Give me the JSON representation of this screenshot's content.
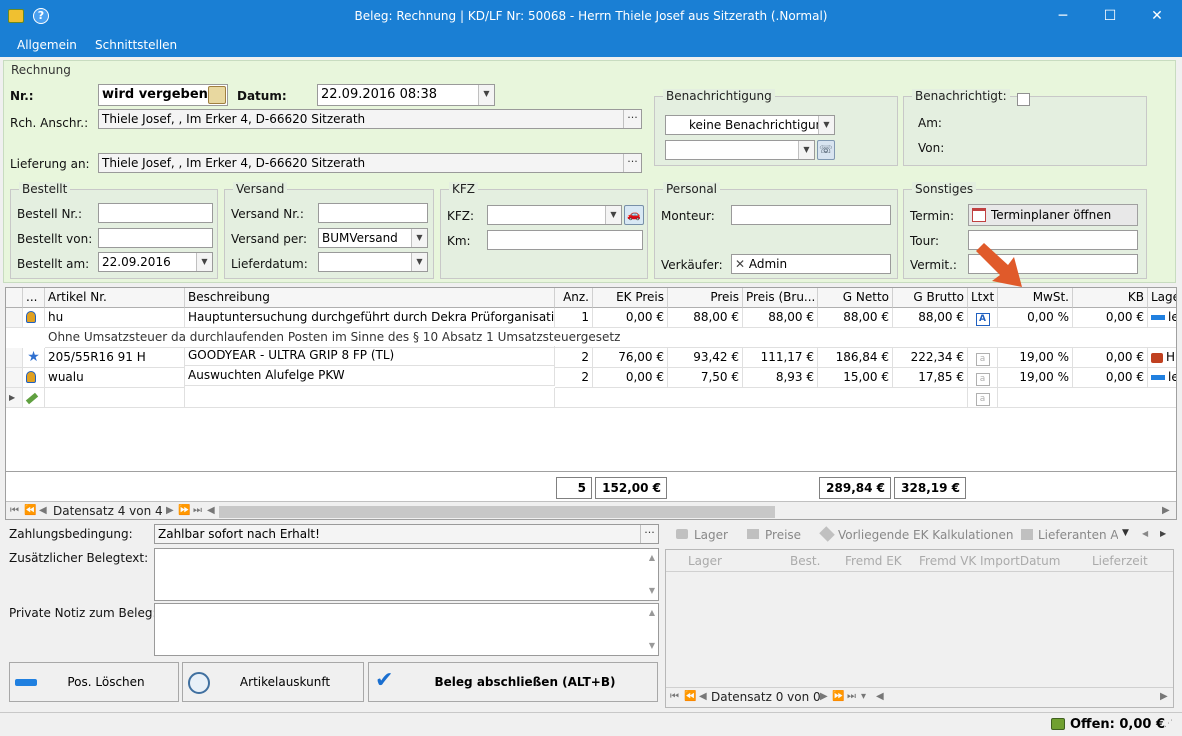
{
  "window": {
    "title": "Beleg: Rechnung |  KD/LF Nr: 50068 - Herrn Thiele Josef aus Sitzerath (.Normal)",
    "minimize": "─",
    "maximize": "☐",
    "close": "✕"
  },
  "menu": {
    "items": [
      "Allgemein",
      "Schnittstellen"
    ]
  },
  "rechnung": {
    "group_label": "Rechnung",
    "nr_label": "Nr.:",
    "nr_value": "wird vergeben",
    "datum_label": "Datum:",
    "datum_value": "22.09.2016 08:38",
    "anschr_label": "Rch. Anschr.:",
    "anschr_value": "Thiele Josef, , Im Erker 4, D-66620 Sitzerath",
    "lieferung_label": "Lieferung an:",
    "lieferung_value": "Thiele Josef, , Im Erker 4, D-66620 Sitzerath"
  },
  "benachrichtigung": {
    "group_label": "Benachrichtigung",
    "value": "keine Benachrichtigung",
    "second_value": ""
  },
  "benachrichtigt": {
    "group_label": "Benachrichtigt:",
    "am_label": "Am:",
    "von_label": "Von:"
  },
  "bestellt": {
    "group_label": "Bestellt",
    "nr_label": "Bestell Nr.:",
    "nr_value": "",
    "von_label": "Bestellt von:",
    "von_value": "",
    "am_label": "Bestellt am:",
    "am_value": "22.09.2016"
  },
  "versand": {
    "group_label": "Versand",
    "nr_label": "Versand Nr.:",
    "nr_value": "",
    "per_label": "Versand per:",
    "per_value": "BUMVersand",
    "datum_label": "Lieferdatum:",
    "datum_value": ""
  },
  "kfz": {
    "group_label": "KFZ",
    "kfz_label": "KFZ:",
    "kfz_value": "",
    "km_label": "Km:",
    "km_value": ""
  },
  "personal": {
    "group_label": "Personal",
    "monteur_label": "Monteur:",
    "monteur_value": "",
    "verkaeufer_label": "Verkäufer:",
    "verkaeufer_value": "Admin"
  },
  "sonstiges": {
    "group_label": "Sonstiges",
    "termin_label": "Termin:",
    "termin_button": "Terminplaner öffnen",
    "tour_label": "Tour:",
    "tour_value": "",
    "vermit_label": "Vermit.:",
    "vermit_value": ""
  },
  "grid": {
    "columns": [
      "...",
      "Artikel Nr.",
      "Beschreibung",
      "Anz.",
      "EK Preis",
      "Preis",
      "Preis (Bru...",
      "G Netto",
      "G Brutto",
      "Ltxt",
      "MwSt.",
      "KB",
      "Lage"
    ],
    "rows": [
      {
        "artikel": "hu",
        "beschreibung": "Hauptuntersuchung durchgeführt durch Dekra Prüforganisation.",
        "anz": "1",
        "ek": "0,00 €",
        "preis": "88,00 €",
        "brutto": "88,00 €",
        "gnetto": "88,00 €",
        "gbrutto": "88,00 €",
        "mwst": "0,00 %",
        "kb": "0,00 €",
        "lager": "le"
      },
      {
        "artikel": "205/55R16 91 H",
        "beschreibung": "GOODYEAR - ULTRA GRIP 8 FP (TL)",
        "anz": "2",
        "ek": "76,00 €",
        "preis": "93,42 €",
        "brutto": "111,17 €",
        "gnetto": "186,84 €",
        "gbrutto": "222,34 €",
        "mwst": "19,00 %",
        "kb": "0,00 €",
        "lager": "H"
      },
      {
        "artikel": "wualu",
        "beschreibung": "Auswuchten Alufelge PKW",
        "anz": "2",
        "ek": "0,00 €",
        "preis": "7,50 €",
        "brutto": "8,93 €",
        "gnetto": "15,00 €",
        "gbrutto": "17,85 €",
        "mwst": "19,00 %",
        "kb": "0,00 €",
        "lager": "le"
      }
    ],
    "note": "Ohne Umsatzsteuer da durchlaufenden Posten im Sinne des § 10 Absatz 1 Umsatzsteuergesetz",
    "totals": {
      "anz": "5",
      "ek": "152,00 €",
      "gnetto": "289,84 €",
      "gbrutto": "328,19 €"
    },
    "record_nav": "Datensatz 4 von 4"
  },
  "footer": {
    "zahlung_label": "Zahlungsbedingung:",
    "zahlung_value": "Zahlbar sofort nach Erhalt!",
    "belegtext_label": "Zusätzlicher Belegtext:",
    "notiz_label": "Private Notiz zum Beleg:",
    "btn_loeschen": "Pos. Löschen",
    "btn_artikel": "Artikelauskunft",
    "btn_abschliessen": "Beleg abschließen (ALT+B)"
  },
  "sidepanel": {
    "tabs": [
      "Lager",
      "Preise",
      "Vorliegende EK Kalkulationen",
      "Lieferanten Ar"
    ],
    "columns": [
      "Lager",
      "Best.",
      "Fremd EK",
      "Fremd VK",
      "ImportDatum",
      "Lieferzeit"
    ],
    "record_nav": "Datensatz 0 von 0"
  },
  "status": {
    "offen": "Offen: 0,00 €"
  },
  "colors": {
    "titlebar": "#1a7fd4",
    "header_bg": "#e8f6dc",
    "arrow": "#e05a2a"
  }
}
